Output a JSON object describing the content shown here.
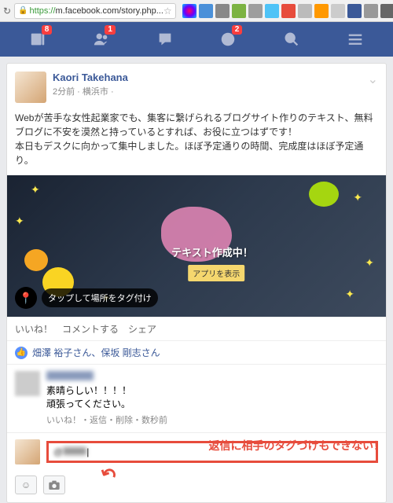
{
  "browser": {
    "url_prefix": "https://",
    "url": "m.facebook.com/story.php..."
  },
  "header": {
    "badges": {
      "news": "8",
      "friends": "1",
      "notifications": "2"
    }
  },
  "post": {
    "author": "Kaori Takehana",
    "meta": "2分前 · 横浜市 ·",
    "body_line1": "Webが苦手な女性起業家でも、集客に繋げられるブログサイト作りのテキスト、無料ブログに不安を漠然と持っているとすれば、お役に立つはずです！",
    "body_line2": "本日もデスクに向かって集中しました。ほぼ予定通りの時間、完成度はほぼ予定通り。",
    "image_text": "テキスト作成中！",
    "image_button": "アプリを表示",
    "tag_location": "タップして場所をタグ付け"
  },
  "actions": {
    "like": "いいね！",
    "comment": "コメントする",
    "share": "シェア"
  },
  "likes_text": "畑澤 裕子さん、保坂 剛志さん",
  "comment": {
    "line1": "素晴らしい！！！！",
    "line2": "頑張ってください。",
    "actions": "いいね！・返信・削除・数秒前"
  },
  "reply": {
    "value": "@"
  },
  "annotation": "返信に相手のタグづけもできない！"
}
